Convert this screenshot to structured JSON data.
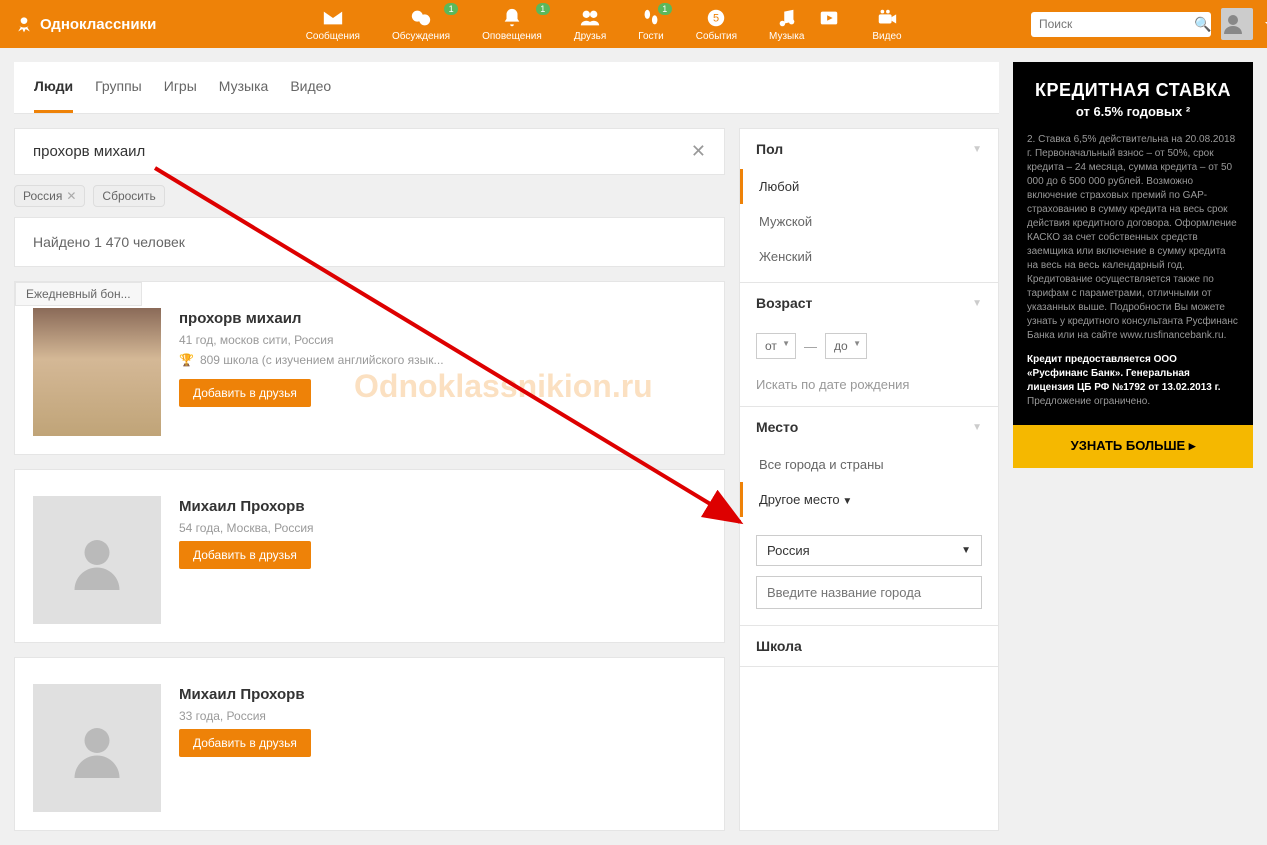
{
  "header": {
    "logo": "Одноклассники",
    "nav": [
      {
        "label": "Сообщения",
        "badge": null
      },
      {
        "label": "Обсуждения",
        "badge": "1"
      },
      {
        "label": "Оповещения",
        "badge": "1"
      },
      {
        "label": "Друзья",
        "badge": null
      },
      {
        "label": "Гости",
        "badge": "1"
      },
      {
        "label": "События",
        "badge": null
      },
      {
        "label": "Музыка",
        "badge": null
      },
      {
        "label": "Видео",
        "badge": null
      }
    ],
    "search_placeholder": "Поиск"
  },
  "tabs": [
    "Люди",
    "Группы",
    "Игры",
    "Музыка",
    "Видео"
  ],
  "active_tab": 0,
  "query": "прохорв михаил",
  "chips": {
    "country": "Россия",
    "reset": "Сбросить"
  },
  "results_header": "Найдено 1 470 человек",
  "bonus_badge": "Ежедневный бон...",
  "add_button": "Добавить в друзья",
  "results": [
    {
      "name": "прохорв михаил",
      "sub": "41 год, москов сити, Россия",
      "school": "809 школа (с изучением английского язык...",
      "has_photo": true
    },
    {
      "name": "Михаил Прохорв",
      "sub": "54 года, Москва, Россия",
      "school": null,
      "has_photo": false
    },
    {
      "name": "Михаил Прохорв",
      "sub": "33 года, Россия",
      "school": null,
      "has_photo": false
    }
  ],
  "filters": {
    "gender": {
      "title": "Пол",
      "options": [
        "Любой",
        "Мужской",
        "Женский"
      ],
      "selected": 0
    },
    "age": {
      "title": "Возраст",
      "from": "от",
      "to": "до",
      "birthday_link": "Искать по дате рождения"
    },
    "place": {
      "title": "Место",
      "all": "Все города и страны",
      "other": "Другое место",
      "country": "Россия",
      "city_placeholder": "Введите название города"
    },
    "school": {
      "title": "Школа"
    }
  },
  "ad": {
    "title": "КРЕДИТНАЯ СТАВКА",
    "sub": "от 6.5% годовых ²",
    "text1": "2. Ставка 6,5% действительна на 20.08.2018 г. Первоначальный взнос – от 50%, срок кредита – 24 месяца, сумма кредита – от 50 000 до 6 500 000 рублей. Возможно включение страховых премий по GAP-страхованию в сумму кредита на весь срок действия кредитного договора. Оформление КАСКО за счет собственных средств заемщика или включение в сумму кредита на весь на весь календарный год. Кредитование осуществляется также по тарифам с параметрами, отличными от указанных выше. Подробности Вы можете узнать у кредитного консультанта Русфинанс Банка или на сайте www.rusfinancebank.ru.",
    "text2": "Кредит предоставляется ООО «Русфинанс Банк». Генеральная лицензия ЦБ РФ №1792 от 13.02.2013 г.",
    "text3": "Предложение ограничено.",
    "button": "УЗНАТЬ БОЛЬШЕ ▸"
  },
  "watermark": "Odnoklassnikion.ru"
}
